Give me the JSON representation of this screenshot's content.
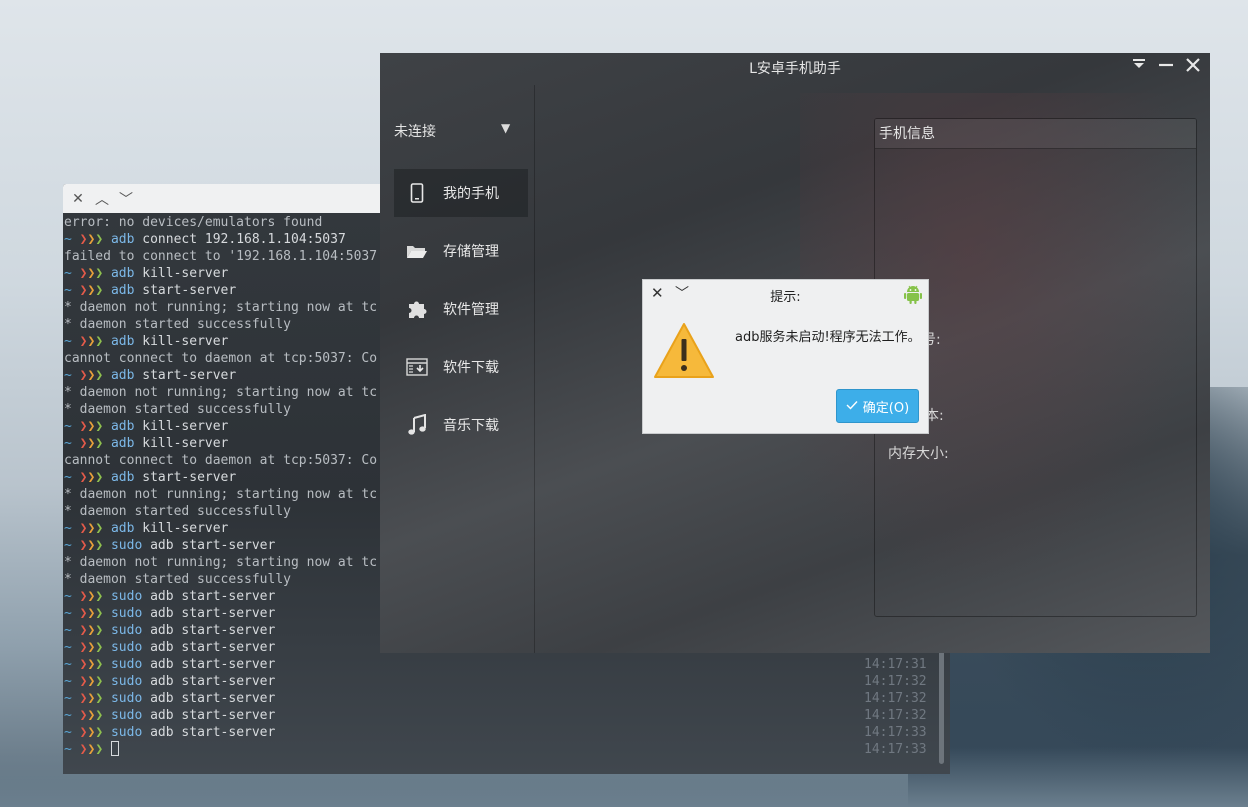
{
  "terminal": {
    "titlebar_icons": [
      "close-icon",
      "chevron-up-icon",
      "chevron-down-icon"
    ],
    "lines": [
      {
        "type": "out",
        "text": "error: no devices/emulators found"
      },
      {
        "type": "cmd",
        "cmd": "adb",
        "args": "connect 192.168.1.104:5037"
      },
      {
        "type": "out",
        "text": "failed to connect to '192.168.1.104:5037"
      },
      {
        "type": "cmd",
        "cmd": "adb",
        "args": "kill-server"
      },
      {
        "type": "cmd",
        "cmd": "adb",
        "args": "start-server"
      },
      {
        "type": "out",
        "text": "* daemon not running; starting now at tc"
      },
      {
        "type": "out",
        "text": "* daemon started successfully"
      },
      {
        "type": "cmd",
        "cmd": "adb",
        "args": "kill-server"
      },
      {
        "type": "out",
        "text": "cannot connect to daemon at tcp:5037: Co"
      },
      {
        "type": "cmd",
        "cmd": "adb",
        "args": "start-server"
      },
      {
        "type": "out",
        "text": "* daemon not running; starting now at tc"
      },
      {
        "type": "out",
        "text": "* daemon started successfully"
      },
      {
        "type": "cmd",
        "cmd": "adb",
        "args": "kill-server"
      },
      {
        "type": "cmd",
        "cmd": "adb",
        "args": "kill-server"
      },
      {
        "type": "out",
        "text": "cannot connect to daemon at tcp:5037: Co"
      },
      {
        "type": "cmd",
        "cmd": "adb",
        "args": "start-server"
      },
      {
        "type": "out",
        "text": "* daemon not running; starting now at tc"
      },
      {
        "type": "out",
        "text": "* daemon started successfully"
      },
      {
        "type": "cmd",
        "cmd": "adb",
        "args": "kill-server"
      },
      {
        "type": "cmd",
        "cmd": "sudo",
        "args": "adb start-server"
      },
      {
        "type": "out",
        "text": "* daemon not running; starting now at tc"
      },
      {
        "type": "out",
        "text": "* daemon started successfully"
      },
      {
        "type": "cmd",
        "cmd": "sudo",
        "args": "adb start-server"
      },
      {
        "type": "cmd",
        "cmd": "sudo",
        "args": "adb start-server"
      },
      {
        "type": "cmd",
        "cmd": "sudo",
        "args": "adb start-server"
      },
      {
        "type": "cmd",
        "cmd": "sudo",
        "args": "adb start-server"
      },
      {
        "type": "cmd",
        "cmd": "sudo",
        "args": "adb start-server",
        "time": "14:17:31"
      },
      {
        "type": "cmd",
        "cmd": "sudo",
        "args": "adb start-server",
        "time": "14:17:32"
      },
      {
        "type": "cmd",
        "cmd": "sudo",
        "args": "adb start-server",
        "time": "14:17:32"
      },
      {
        "type": "cmd",
        "cmd": "sudo",
        "args": "adb start-server",
        "time": "14:17:32"
      },
      {
        "type": "cmd",
        "cmd": "sudo",
        "args": "adb start-server",
        "time": "14:17:33"
      },
      {
        "type": "prompt",
        "time": "14:17:33"
      }
    ],
    "prompt": {
      "tilde": "~",
      "arrows": "❯❯❯"
    }
  },
  "app": {
    "title": "L安卓手机助手",
    "window_icons": [
      "minimize-to-tray-icon",
      "minimize-icon",
      "close-icon"
    ],
    "connection": {
      "label": "未连接"
    },
    "nav": [
      {
        "label": "我的手机",
        "icon": "phone-icon",
        "active": true
      },
      {
        "label": "存储管理",
        "icon": "folder-icon",
        "active": false
      },
      {
        "label": "软件管理",
        "icon": "puzzle-icon",
        "active": false
      },
      {
        "label": "软件下载",
        "icon": "download-icon",
        "active": false
      },
      {
        "label": "音乐下载",
        "icon": "music-note-icon",
        "active": false
      }
    ],
    "info_panel": {
      "title": "手机信息",
      "fragments": [
        "号:",
        "本:"
      ],
      "memory_label": "内存大小:"
    }
  },
  "dialog": {
    "title": "提示:",
    "message": "adb服务未启动!程序无法工作。",
    "ok_label": "确定(O)",
    "icons": [
      "close-icon",
      "chevron-down-icon",
      "android-icon",
      "warning-icon",
      "checkmark-icon"
    ]
  }
}
